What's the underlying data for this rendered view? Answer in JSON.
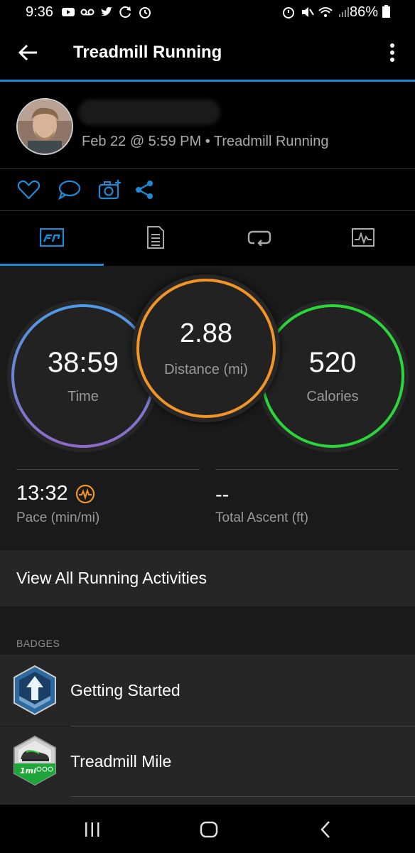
{
  "status_bar": {
    "time": "9:36",
    "battery": "86%"
  },
  "app_bar": {
    "title": "Treadmill Running"
  },
  "activity": {
    "meta": "Feb 22 @ 5:59 PM • Treadmill Running"
  },
  "summary": {
    "time": {
      "value": "38:59",
      "label": "Time"
    },
    "distance": {
      "value": "2.88",
      "label": "Distance (mi)"
    },
    "calories": {
      "value": "520",
      "label": "Calories"
    },
    "pace": {
      "value": "13:32",
      "label": "Pace (min/mi)"
    },
    "ascent": {
      "value": "--",
      "label": "Total Ascent (ft)"
    }
  },
  "view_all_label": "View All Running Activities",
  "badges": {
    "header": "BADGES",
    "items": [
      {
        "label": "Getting Started"
      },
      {
        "label": "Treadmill Mile"
      }
    ]
  },
  "colors": {
    "accent": "#1e8ad6",
    "time_ring": "#5b8fd9",
    "distance_ring": "#f29426",
    "calories_ring": "#2bd63a"
  }
}
